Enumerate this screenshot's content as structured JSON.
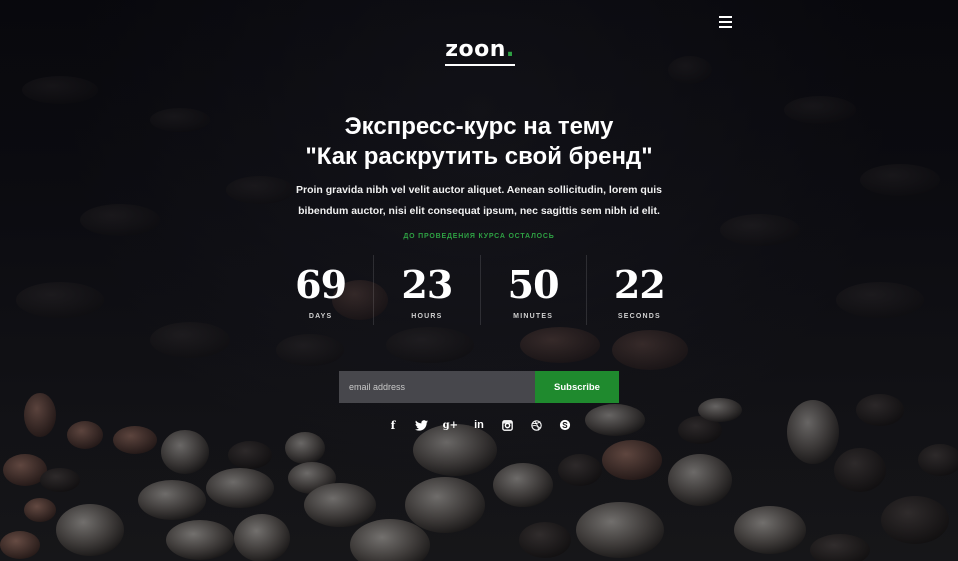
{
  "brand": {
    "name": "zoon",
    "dot": ".",
    "accent_color": "#2ea043"
  },
  "menu": {
    "icon": "hamburger-menu-icon"
  },
  "hero": {
    "title_line1": "Экспресс-курс на тему",
    "title_line2": "\"Как раскрутить свой бренд\"",
    "lead_line1": "Proin gravida nibh vel velit auctor aliquet. Aenean sollicitudin, lorem quis",
    "lead_line2": "bibendum auctor, nisi elit consequat ipsum, nec sagittis sem nibh id elit."
  },
  "countdown": {
    "label": "ДО ПРОВЕДЕНИЯ КУРСА ОСТАЛОСЬ",
    "days": {
      "value": "69",
      "unit": "DAYS"
    },
    "hours": {
      "value": "23",
      "unit": "HOURS"
    },
    "minutes": {
      "value": "50",
      "unit": "MINUTES"
    },
    "seconds": {
      "value": "22",
      "unit": "SECONDS"
    }
  },
  "subscribe": {
    "placeholder": "email address",
    "value": "",
    "button_label": "Subscribe",
    "button_color": "#1f8a2e"
  },
  "social": {
    "icons": [
      "facebook-icon",
      "twitter-icon",
      "google-plus-icon",
      "linkedin-icon",
      "instagram-icon",
      "dribbble-icon",
      "skype-icon"
    ],
    "facebook": "f",
    "google_plus": "g+",
    "linkedin": "in"
  }
}
